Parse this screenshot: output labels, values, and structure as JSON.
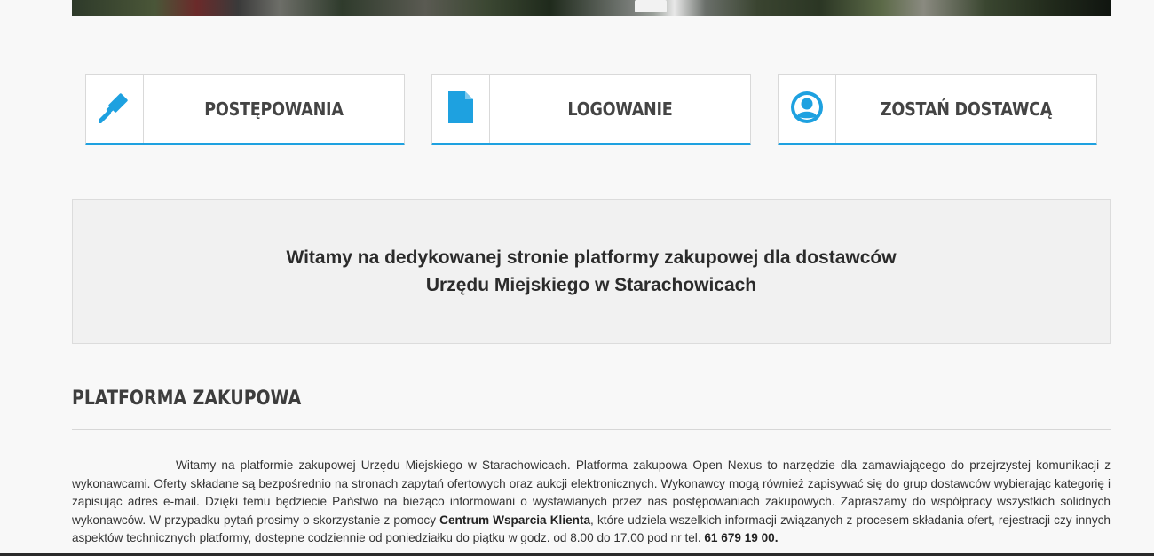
{
  "tiles": [
    {
      "label": "POSTĘPOWANIA",
      "icon": "gavel-icon"
    },
    {
      "label": "LOGOWANIE",
      "icon": "document-icon"
    },
    {
      "label": "ZOSTAŃ DOSTAWCĄ",
      "icon": "user-circle-icon"
    }
  ],
  "welcome": {
    "line1": "Witamy na dedykowanej stronie platformy zakupowej dla dostawców",
    "line2": "Urzędu Miejskiego w Starachowicach"
  },
  "section": {
    "title": "PLATFORMA ZAKUPOWA",
    "text_part1": "Witamy na platformie zakupowej Urzędu Miejskiego w Starachowicach. Platforma zakupowa Open Nexus to narzędzie dla zamawiającego do przejrzystej komunikacji z wykonawcami. Oferty składane są bezpośrednio na stronach zapytań ofertowych oraz aukcji elektronicznych. Wykonawcy mogą również zapisywać się do grup dostawców wybierając kategorię i zapisując adres e-mail. Dzięki temu będziecie Państwo na bieżąco informowani o wystawianych przez nas postępowaniach zakupowych. Zapraszamy do współpracy wszystkich solidnych wykonawców. W przypadku pytań prosimy o skorzystanie z pomocy ",
    "support_link": "Centrum Wsparcia Klienta",
    "text_part2": ", które udziela wszelkich informacji związanych z procesem składania ofert, rejestracji czy innych aspektów technicznych platformy, dostępne codziennie od poniedziałku do piątku w godz. od 8.00 do 17.00 pod nr tel. ",
    "phone": "61 679 19 00."
  },
  "colors": {
    "accent": "#1ea1e0",
    "background": "#f8f8f8",
    "welcome_bg": "#f1f1f1"
  }
}
